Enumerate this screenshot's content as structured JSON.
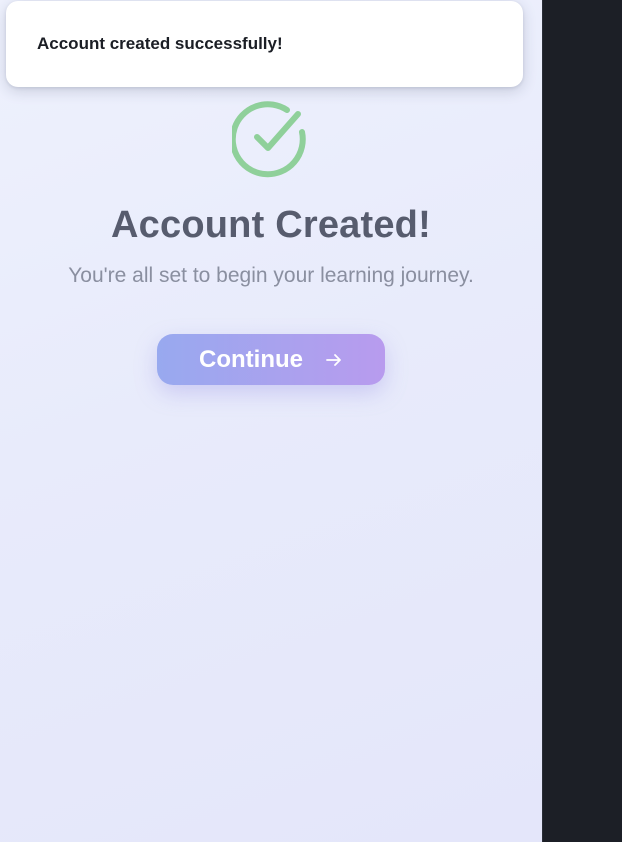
{
  "toast": {
    "message": "Account created successfully!"
  },
  "main": {
    "title": "Account Created!",
    "subtitle": "You're all set to begin your learning journey.",
    "continue_label": "Continue"
  },
  "icons": {
    "success": "check-circle-icon",
    "continue": "arrow-right-icon"
  },
  "colors": {
    "success_green": "#8fd09a",
    "button_gradient_start": "#98a9ef",
    "button_gradient_end": "#b89bee",
    "title_text": "#575c6e",
    "subtitle_text": "#8a8fa0",
    "side_panel": "#1c1f26"
  }
}
